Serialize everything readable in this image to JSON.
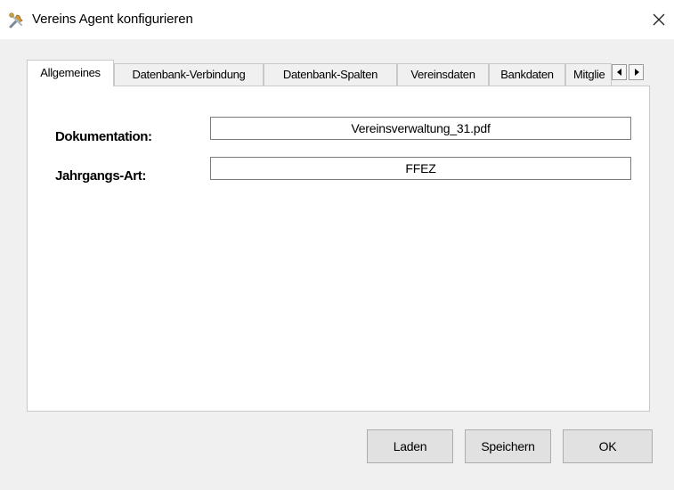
{
  "window": {
    "title": "Vereins Agent konfigurieren",
    "app_icon": "tools-icon",
    "close_icon": "close-icon"
  },
  "tabs": [
    {
      "label": "Allgemeines",
      "active": true
    },
    {
      "label": "Datenbank-Verbindung",
      "active": false
    },
    {
      "label": "Datenbank-Spalten",
      "active": false
    },
    {
      "label": "Vereinsdaten",
      "active": false
    },
    {
      "label": "Bankdaten",
      "active": false
    },
    {
      "label": "Mitglie",
      "active": false
    }
  ],
  "tab_scroll": {
    "left_icon": "arrow-left-icon",
    "right_icon": "arrow-right-icon"
  },
  "general": {
    "documentation_label": "Dokumentation:",
    "documentation_value": "Vereinsverwaltung_31.pdf",
    "year_type_label": "Jahrgangs-Art:",
    "year_type_value": "FFEZ"
  },
  "buttons": {
    "load": "Laden",
    "save": "Speichern",
    "ok": "OK"
  }
}
